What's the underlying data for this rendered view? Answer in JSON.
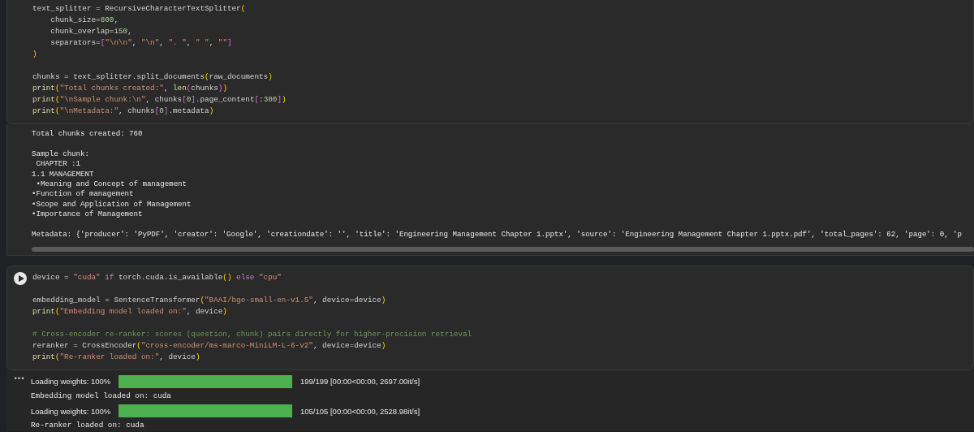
{
  "cells": [
    {
      "code": [
        [
          [
            {
              "text": "text_splitter = RecursiveCharacterTextSplitter",
              "kind": "plain"
            },
            {
              "text": "(",
              "kind": "b1"
            }
          ],
          [
            {
              "text": "    chunk_size=",
              "kind": "plain"
            },
            {
              "text": "800",
              "kind": "num"
            },
            {
              "text": ",",
              "kind": "plain"
            }
          ],
          [
            {
              "text": "    chunk_overlap=",
              "kind": "plain"
            },
            {
              "text": "150",
              "kind": "num"
            },
            {
              "text": ",",
              "kind": "plain"
            }
          ],
          [
            {
              "text": "    separators=",
              "kind": "plain"
            },
            {
              "text": "[",
              "kind": "b2"
            },
            {
              "text": "\"\\n\\n\"",
              "kind": "str"
            },
            {
              "text": ", ",
              "kind": "plain"
            },
            {
              "text": "\"\\n\"",
              "kind": "str"
            },
            {
              "text": ", ",
              "kind": "plain"
            },
            {
              "text": "\". \"",
              "kind": "str"
            },
            {
              "text": ", ",
              "kind": "plain"
            },
            {
              "text": "\" \"",
              "kind": "str"
            },
            {
              "text": ", ",
              "kind": "plain"
            },
            {
              "text": "\"\"",
              "kind": "str"
            },
            {
              "text": "]",
              "kind": "b2"
            }
          ],
          [
            {
              "text": ")",
              "kind": "b1"
            }
          ]
        ],
        [
          [
            {
              "text": "chunks = text_splitter.split_documents",
              "kind": "plain"
            },
            {
              "text": "(",
              "kind": "b1"
            },
            {
              "text": "raw_documents",
              "kind": "plain"
            },
            {
              "text": ")",
              "kind": "b1"
            }
          ],
          [
            {
              "text": "print",
              "kind": "fn"
            },
            {
              "text": "(",
              "kind": "b1"
            },
            {
              "text": "\"Total chunks created:\"",
              "kind": "str"
            },
            {
              "text": ", ",
              "kind": "plain"
            },
            {
              "text": "len",
              "kind": "fn"
            },
            {
              "text": "(",
              "kind": "b2"
            },
            {
              "text": "chunks",
              "kind": "plain"
            },
            {
              "text": ")",
              "kind": "b2"
            },
            {
              "text": ")",
              "kind": "b1"
            }
          ],
          [
            {
              "text": "print",
              "kind": "fn"
            },
            {
              "text": "(",
              "kind": "b1"
            },
            {
              "text": "\"\\nSample chunk:\\n\"",
              "kind": "str"
            },
            {
              "text": ", chunks",
              "kind": "plain"
            },
            {
              "text": "[",
              "kind": "b2"
            },
            {
              "text": "0",
              "kind": "num"
            },
            {
              "text": "]",
              "kind": "b2"
            },
            {
              "text": ".page_content",
              "kind": "plain"
            },
            {
              "text": "[",
              "kind": "b2"
            },
            {
              "text": ":",
              "kind": "plain"
            },
            {
              "text": "300",
              "kind": "num"
            },
            {
              "text": "]",
              "kind": "b2"
            },
            {
              "text": ")",
              "kind": "b1"
            }
          ],
          [
            {
              "text": "print",
              "kind": "fn"
            },
            {
              "text": "(",
              "kind": "b1"
            },
            {
              "text": "\"\\nMetadata:\"",
              "kind": "str"
            },
            {
              "text": ", chunks",
              "kind": "plain"
            },
            {
              "text": "[",
              "kind": "b2"
            },
            {
              "text": "0",
              "kind": "num"
            },
            {
              "text": "]",
              "kind": "b2"
            },
            {
              "text": ".metadata",
              "kind": "plain"
            },
            {
              "text": ")",
              "kind": "b1"
            }
          ]
        ]
      ],
      "output_scrollbar": true,
      "output": [
        {
          "kind": "text",
          "lines": [
            "Total chunks created: 760"
          ]
        },
        {
          "kind": "text",
          "lines": [
            "Sample chunk:",
            " CHAPTER :1",
            "1.1 MANAGEMENT",
            " •Meaning and Concept of management",
            "•Function of management",
            "•Scope and Application of Management",
            "•Importance of Management"
          ]
        },
        {
          "kind": "text",
          "lines": [
            "Metadata: {'producer': 'PyPDF', 'creator': 'Google', 'creationdate': '', 'title': 'Engineering Management Chapter 1.pptx', 'source': 'Engineering Management Chapter 1.pptx.pdf', 'total_pages': 62, 'page': 0, 'p"
          ]
        }
      ]
    },
    {
      "run_button": true,
      "code": [
        [
          [
            {
              "text": "device = ",
              "kind": "plain"
            },
            {
              "text": "\"cuda\"",
              "kind": "str"
            },
            {
              "text": " if",
              "kind": "kw"
            },
            {
              "text": " torch.cuda.is_available",
              "kind": "plain"
            },
            {
              "text": "()",
              "kind": "b1"
            },
            {
              "text": " else ",
              "kind": "kw"
            },
            {
              "text": "\"cpu\"",
              "kind": "str"
            }
          ]
        ],
        [
          [
            {
              "text": "embedding_model = SentenceTransformer",
              "kind": "plain"
            },
            {
              "text": "(",
              "kind": "b1"
            },
            {
              "text": "\"BAAI/bge-small-en-v1.5\"",
              "kind": "str"
            },
            {
              "text": ", device=device",
              "kind": "plain"
            },
            {
              "text": ")",
              "kind": "b1"
            }
          ],
          [
            {
              "text": "print",
              "kind": "fn"
            },
            {
              "text": "(",
              "kind": "b1"
            },
            {
              "text": "\"Embedding model loaded on:\"",
              "kind": "str"
            },
            {
              "text": ", device",
              "kind": "plain"
            },
            {
              "text": ")",
              "kind": "b1"
            }
          ]
        ],
        [
          [
            {
              "text": "# Cross-encoder re-ranker: scores (question, chunk) pairs directly for higher-precision retrieval",
              "kind": "comment"
            }
          ],
          [
            {
              "text": "reranker = CrossEncoder",
              "kind": "plain"
            },
            {
              "text": "(",
              "kind": "b1"
            },
            {
              "text": "\"cross-encoder/ms-marco-MiniLM-L-6-v2\"",
              "kind": "str"
            },
            {
              "text": ", device=device",
              "kind": "plain"
            },
            {
              "text": ")",
              "kind": "b1"
            }
          ],
          [
            {
              "text": "print",
              "kind": "fn"
            },
            {
              "text": "(",
              "kind": "b1"
            },
            {
              "text": "\"Re-ranker loaded on:\"",
              "kind": "str"
            },
            {
              "text": ", device",
              "kind": "plain"
            },
            {
              "text": ")",
              "kind": "b1"
            }
          ]
        ]
      ],
      "output_menu": "•••",
      "output": [
        {
          "kind": "progress",
          "label": "Loading weights: 100%",
          "level": 1,
          "status": "199/199 [00:00<00:00, 2697.00it/s]"
        },
        {
          "kind": "text",
          "lines": [
            "Embedding model loaded on: cuda"
          ]
        },
        {
          "kind": "progress",
          "label": "Loading weights: 100%",
          "level": 1,
          "status": "105/105 [00:00<00:00, 2528.98it/s]"
        },
        {
          "kind": "text",
          "lines": [
            "Re-ranker loaded on: cuda"
          ]
        }
      ]
    }
  ]
}
